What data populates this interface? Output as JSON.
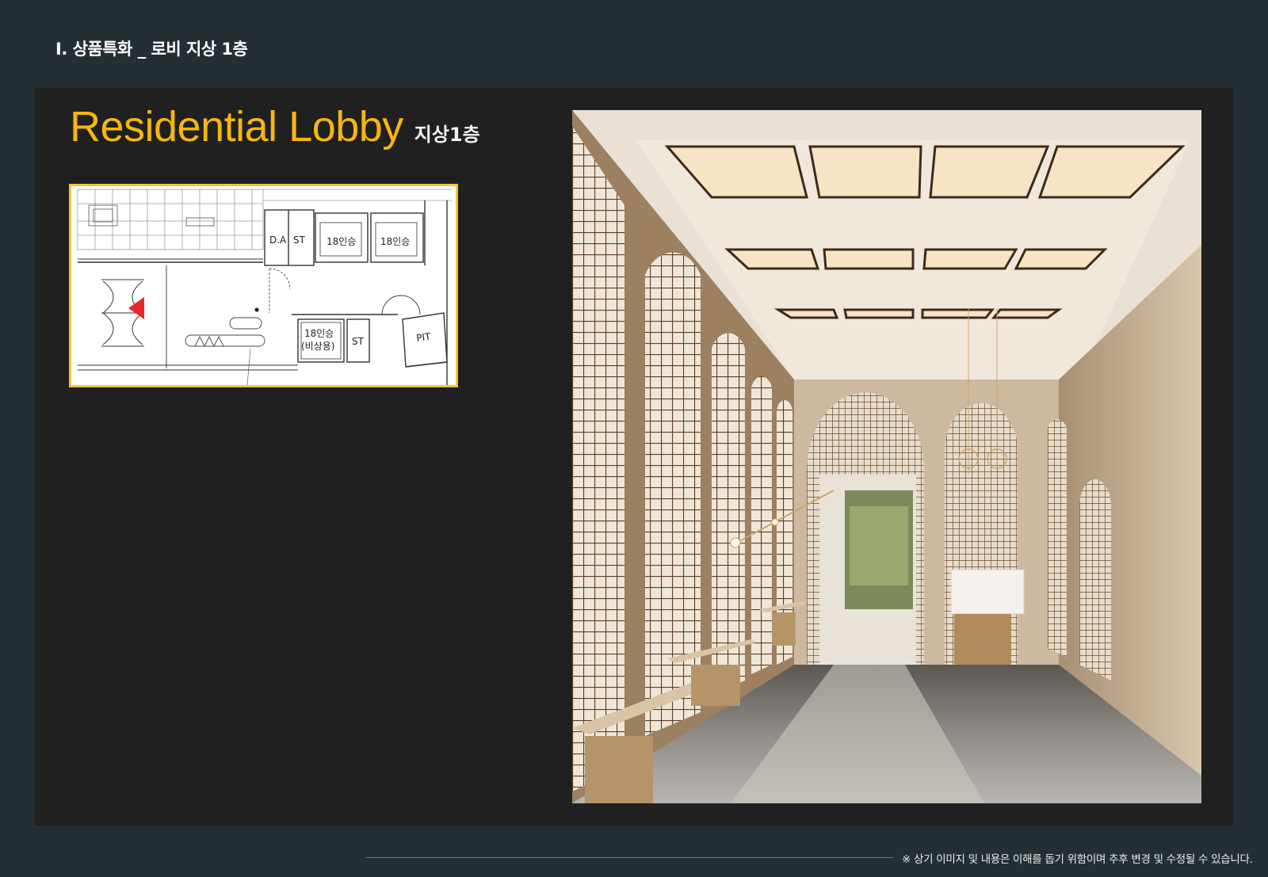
{
  "section_title": "Ⅰ. 상품특화 _ 로비 지상 1층",
  "heading": {
    "title": "Residential Lobby",
    "subtitle": "지상1층"
  },
  "floorplan": {
    "labels": {
      "da": "D.A",
      "st_top": "ST",
      "elevator_1": "18인승",
      "elevator_2": "18인승",
      "elevator_3_line1": "18인승",
      "elevator_3_line2": "(비상용)",
      "st_bottom": "ST",
      "pit": "PIT"
    },
    "view_marker_color": "#e8262b",
    "frame_color": "#f7c33c"
  },
  "colors": {
    "accent": "#f5b60f",
    "background": "#232f33",
    "panel": "#202020"
  },
  "footer": {
    "note": "※ 상기 이미지 및 내용은 이해를 돕기 위함이며 추후 변경 및 수정될 수 있습니다."
  }
}
